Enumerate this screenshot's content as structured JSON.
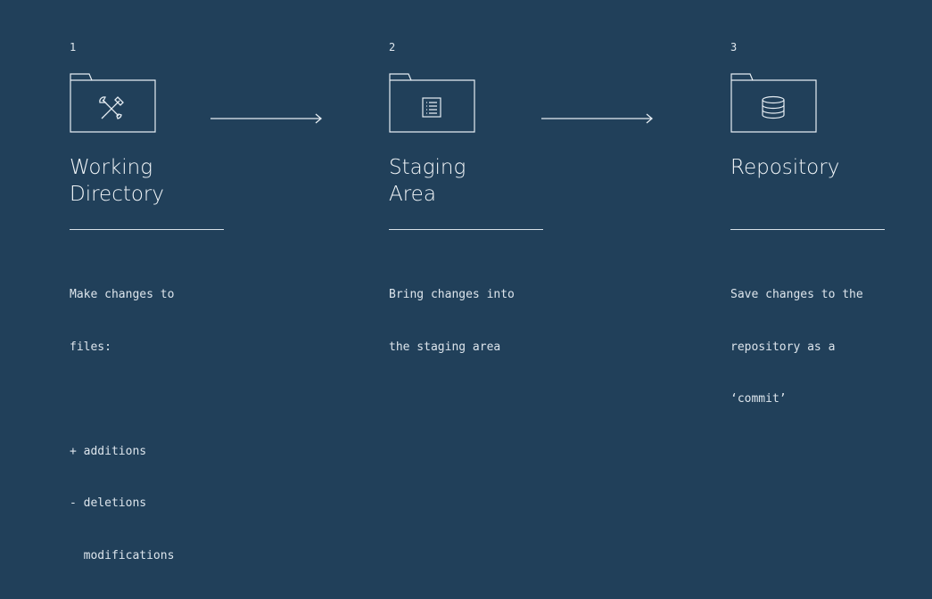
{
  "steps": [
    {
      "number": "1",
      "title_lines": [
        "Working",
        "Directory"
      ],
      "icon": "tools-icon",
      "description_lines": [
        "Make changes to",
        "files:",
        "",
        "+ additions",
        "- deletions",
        "  modifications"
      ]
    },
    {
      "number": "2",
      "title_lines": [
        "Staging",
        "Area"
      ],
      "icon": "list-document-icon",
      "description_lines": [
        "Bring changes into",
        "the staging area"
      ]
    },
    {
      "number": "3",
      "title_lines": [
        "Repository"
      ],
      "icon": "database-icon",
      "description_lines": [
        "Save changes to the",
        "repository as a",
        "‘commit’"
      ]
    }
  ],
  "colors": {
    "background": "#21405a",
    "foreground": "#e8eef3"
  }
}
